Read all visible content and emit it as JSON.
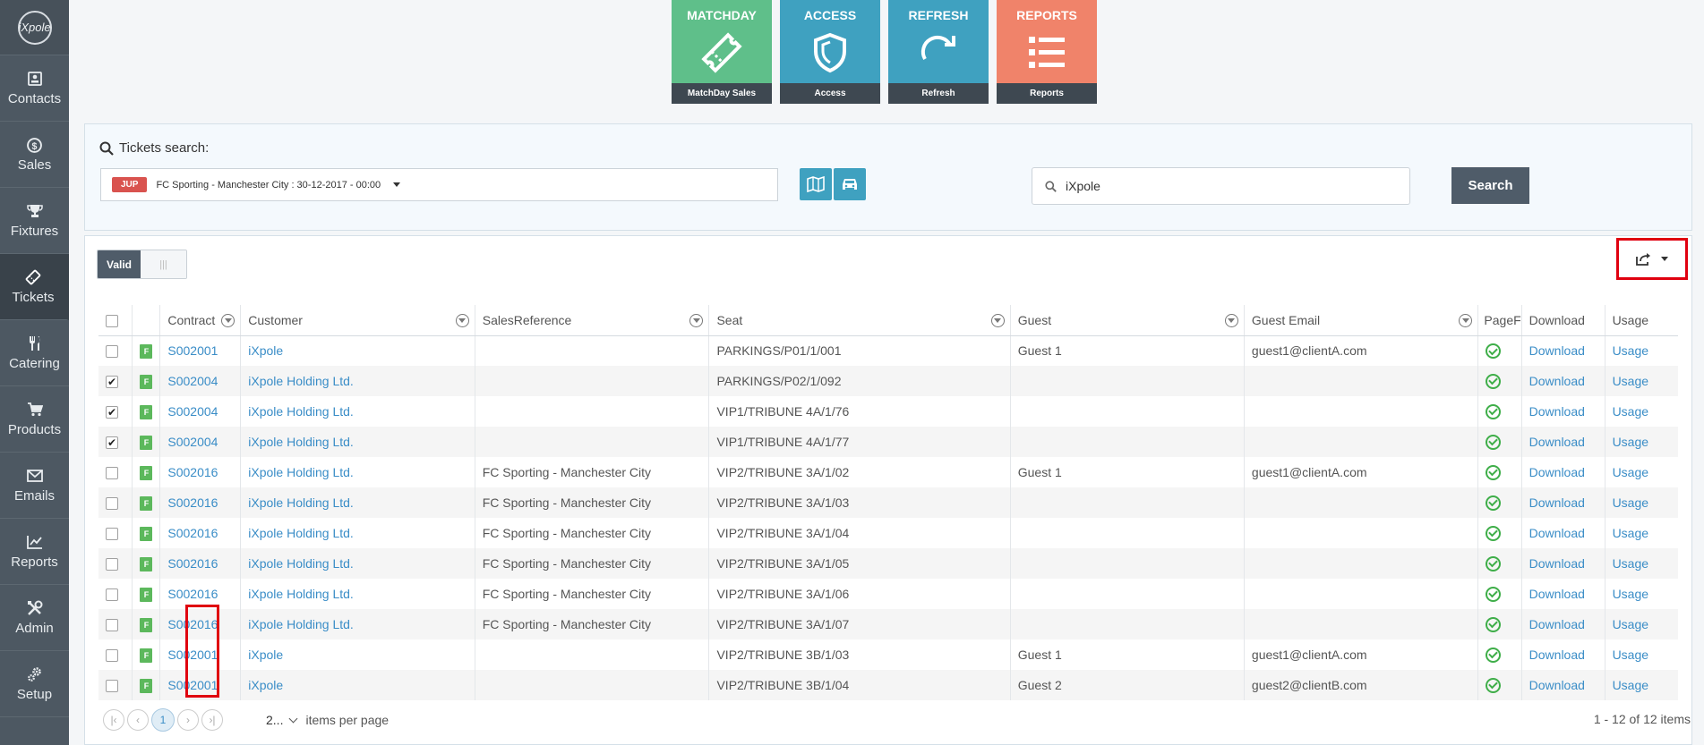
{
  "logo_text": "iXpole",
  "sidebar": {
    "items": [
      {
        "label": "Contacts",
        "icon": "contacts-icon"
      },
      {
        "label": "Sales",
        "icon": "dollar-icon"
      },
      {
        "label": "Fixtures",
        "icon": "trophy-icon"
      },
      {
        "label": "Tickets",
        "icon": "ticket-icon"
      },
      {
        "label": "Catering",
        "icon": "cutlery-icon"
      },
      {
        "label": "Products",
        "icon": "cart-icon"
      },
      {
        "label": "Emails",
        "icon": "envelope-icon"
      },
      {
        "label": "Reports",
        "icon": "chart-icon"
      },
      {
        "label": "Admin",
        "icon": "tools-icon"
      },
      {
        "label": "Setup",
        "icon": "gears-icon"
      }
    ],
    "active": "Tickets"
  },
  "tiles": [
    {
      "title": "MATCHDAY",
      "footer": "MatchDay Sales",
      "color": "#5fbf8a"
    },
    {
      "title": "ACCESS",
      "footer": "Access",
      "color": "#3fa1c0"
    },
    {
      "title": "REFRESH",
      "footer": "Refresh",
      "color": "#3fa1c0"
    },
    {
      "title": "REPORTS",
      "footer": "Reports",
      "color": "#f0836a"
    }
  ],
  "search": {
    "title": "Tickets search:",
    "event_badge": "JUP",
    "event_label": "FC Sporting - Manchester City : 30-12-2017 - 00:00",
    "query": "iXpole",
    "button": "Search"
  },
  "grid": {
    "toggle_on": "Valid",
    "toggle_off": "|||",
    "columns": [
      "Contract",
      "Customer",
      "SalesReference",
      "Seat",
      "Guest",
      "Guest Email",
      "PageF",
      "Download",
      "Usage"
    ],
    "rows": [
      {
        "checked": false,
        "contract": "S002001",
        "customer": "iXpole",
        "salesref": "",
        "seat": "PARKINGS/P01/1/001",
        "guest": "Guest 1",
        "email": "guest1@clientA.com",
        "download": "Download",
        "usage": "Usage"
      },
      {
        "checked": true,
        "contract": "S002004",
        "customer": "iXpole Holding Ltd.",
        "salesref": "",
        "seat": "PARKINGS/P02/1/092",
        "guest": "",
        "email": "",
        "download": "Download",
        "usage": "Usage"
      },
      {
        "checked": true,
        "contract": "S002004",
        "customer": "iXpole Holding Ltd.",
        "salesref": "",
        "seat": "VIP1/TRIBUNE 4A/1/76",
        "guest": "",
        "email": "",
        "download": "Download",
        "usage": "Usage"
      },
      {
        "checked": true,
        "contract": "S002004",
        "customer": "iXpole Holding Ltd.",
        "salesref": "",
        "seat": "VIP1/TRIBUNE 4A/1/77",
        "guest": "",
        "email": "",
        "download": "Download",
        "usage": "Usage"
      },
      {
        "checked": false,
        "contract": "S002016",
        "customer": "iXpole Holding Ltd.",
        "salesref": "FC Sporting - Manchester City",
        "seat": "VIP2/TRIBUNE 3A/1/02",
        "guest": "Guest 1",
        "email": "guest1@clientA.com",
        "download": "Download",
        "usage": "Usage"
      },
      {
        "checked": false,
        "contract": "S002016",
        "customer": "iXpole Holding Ltd.",
        "salesref": "FC Sporting - Manchester City",
        "seat": "VIP2/TRIBUNE 3A/1/03",
        "guest": "",
        "email": "",
        "download": "Download",
        "usage": "Usage"
      },
      {
        "checked": false,
        "contract": "S002016",
        "customer": "iXpole Holding Ltd.",
        "salesref": "FC Sporting - Manchester City",
        "seat": "VIP2/TRIBUNE 3A/1/04",
        "guest": "",
        "email": "",
        "download": "Download",
        "usage": "Usage"
      },
      {
        "checked": false,
        "contract": "S002016",
        "customer": "iXpole Holding Ltd.",
        "salesref": "FC Sporting - Manchester City",
        "seat": "VIP2/TRIBUNE 3A/1/05",
        "guest": "",
        "email": "",
        "download": "Download",
        "usage": "Usage"
      },
      {
        "checked": false,
        "contract": "S002016",
        "customer": "iXpole Holding Ltd.",
        "salesref": "FC Sporting - Manchester City",
        "seat": "VIP2/TRIBUNE 3A/1/06",
        "guest": "",
        "email": "",
        "download": "Download",
        "usage": "Usage"
      },
      {
        "checked": false,
        "contract": "S002016",
        "customer": "iXpole Holding Ltd.",
        "salesref": "FC Sporting - Manchester City",
        "seat": "VIP2/TRIBUNE 3A/1/07",
        "guest": "",
        "email": "",
        "download": "Download",
        "usage": "Usage"
      },
      {
        "checked": false,
        "contract": "S002001",
        "customer": "iXpole",
        "salesref": "",
        "seat": "VIP2/TRIBUNE 3B/1/03",
        "guest": "Guest 1",
        "email": "guest1@clientA.com",
        "download": "Download",
        "usage": "Usage"
      },
      {
        "checked": false,
        "contract": "S002001",
        "customer": "iXpole",
        "salesref": "",
        "seat": "VIP2/TRIBUNE 3B/1/04",
        "guest": "Guest 2",
        "email": "guest2@clientB.com",
        "download": "Download",
        "usage": "Usage"
      }
    ],
    "row_badge": "F",
    "pager": {
      "current": "1",
      "page_size": "2...",
      "per_page_label": "items per page",
      "count": "1 - 12 of 12 items"
    }
  }
}
